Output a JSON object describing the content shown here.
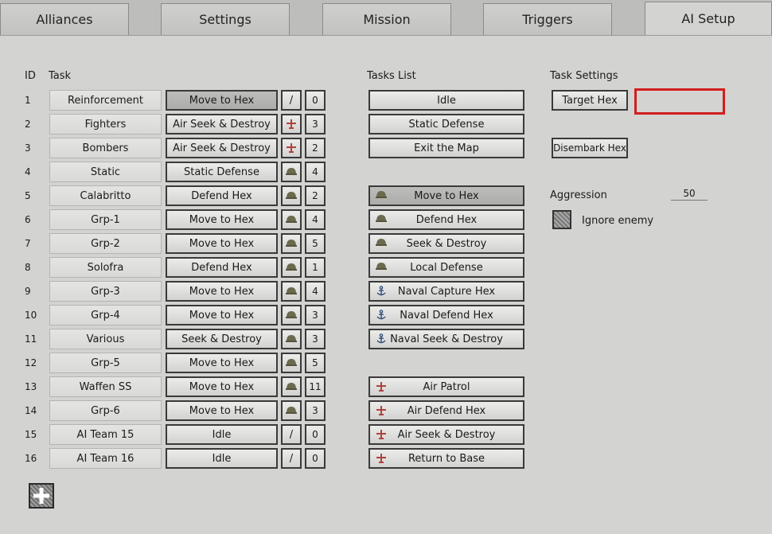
{
  "tabs": [
    "Alliances",
    "Settings",
    "Mission",
    "Triggers",
    "AI Setup"
  ],
  "headers": {
    "id": "ID",
    "task": "Task",
    "tasks_list": "Tasks List",
    "task_settings": "Task Settings"
  },
  "rows": [
    {
      "id": "1",
      "name": "Reinforcement",
      "task": "Move to Hex",
      "icon": "/",
      "num": "0",
      "selected": true
    },
    {
      "id": "2",
      "name": "Fighters",
      "task": "Air Seek & Destroy",
      "icon": "plane",
      "num": "3"
    },
    {
      "id": "3",
      "name": "Bombers",
      "task": "Air Seek & Destroy",
      "icon": "plane",
      "num": "2"
    },
    {
      "id": "4",
      "name": "Static",
      "task": "Static Defense",
      "icon": "helmet",
      "num": "4"
    },
    {
      "id": "5",
      "name": "Calabritto",
      "task": "Defend Hex",
      "icon": "helmet",
      "num": "2"
    },
    {
      "id": "6",
      "name": "Grp-1",
      "task": "Move to Hex",
      "icon": "helmet",
      "num": "4"
    },
    {
      "id": "7",
      "name": "Grp-2",
      "task": "Move to Hex",
      "icon": "helmet",
      "num": "5"
    },
    {
      "id": "8",
      "name": "Solofra",
      "task": "Defend Hex",
      "icon": "helmet",
      "num": "1"
    },
    {
      "id": "9",
      "name": "Grp-3",
      "task": "Move to Hex",
      "icon": "helmet",
      "num": "4"
    },
    {
      "id": "10",
      "name": "Grp-4",
      "task": "Move to Hex",
      "icon": "helmet",
      "num": "3"
    },
    {
      "id": "11",
      "name": "Various",
      "task": "Seek & Destroy",
      "icon": "helmet",
      "num": "3"
    },
    {
      "id": "12",
      "name": "Grp-5",
      "task": "Move to Hex",
      "icon": "helmet",
      "num": "5"
    },
    {
      "id": "13",
      "name": "Waffen SS",
      "task": "Move to Hex",
      "icon": "helmet",
      "num": "11"
    },
    {
      "id": "14",
      "name": "Grp-6",
      "task": "Move to Hex",
      "icon": "helmet",
      "num": "3"
    },
    {
      "id": "15",
      "name": "AI Team 15",
      "task": "Idle",
      "icon": "/",
      "num": "0"
    },
    {
      "id": "16",
      "name": "AI Team 16",
      "task": "Idle",
      "icon": "/",
      "num": "0"
    }
  ],
  "tasks_list": [
    {
      "label": "Idle",
      "icon": "none",
      "slot": 0
    },
    {
      "label": "Static Defense",
      "icon": "none",
      "slot": 1
    },
    {
      "label": "Exit the Map",
      "icon": "none",
      "slot": 2
    },
    {
      "label": "Move to Hex",
      "icon": "helmet",
      "slot": 4,
      "selected": true
    },
    {
      "label": "Defend Hex",
      "icon": "helmet",
      "slot": 5
    },
    {
      "label": "Seek & Destroy",
      "icon": "helmet",
      "slot": 6
    },
    {
      "label": "Local Defense",
      "icon": "helmet",
      "slot": 7
    },
    {
      "label": "Naval Capture Hex",
      "icon": "anchor",
      "slot": 8
    },
    {
      "label": "Naval Defend Hex",
      "icon": "anchor",
      "slot": 9
    },
    {
      "label": "Naval Seek & Destroy",
      "icon": "anchor",
      "slot": 10
    },
    {
      "label": "Air Patrol",
      "icon": "plane",
      "slot": 12
    },
    {
      "label": "Air Defend Hex",
      "icon": "plane",
      "slot": 13
    },
    {
      "label": "Air Seek & Destroy",
      "icon": "plane",
      "slot": 14
    },
    {
      "label": "Return to Base",
      "icon": "plane",
      "slot": 15
    }
  ],
  "settings": {
    "target_hex": "Target Hex",
    "disembark_hex": "Disembark Hex",
    "aggression_label": "Aggression",
    "aggression_value": "50",
    "ignore_enemy_label": "Ignore enemy"
  },
  "colors": {
    "highlight": "#d21e1e"
  }
}
